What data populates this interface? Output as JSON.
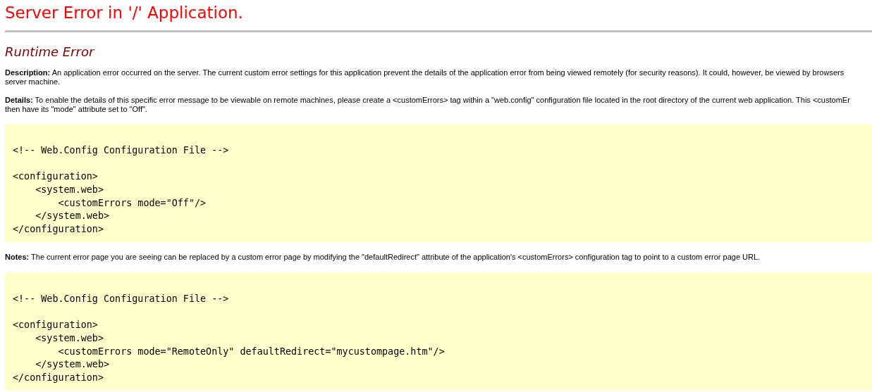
{
  "title": "Server Error in '/' Application.",
  "error_heading": "Runtime Error",
  "description": {
    "lines": [
      "**Description:** An application error occurred on the server. The current custom error settings for this application prevent the details of the application error from being viewed remotely (for security reasons). It could, however, be viewed by browsers",
      "server machine."
    ]
  },
  "details": {
    "lines": [
      "**Details:** To enable the details of this specific error message to be viewable on remote machines, please create a <customErrors> tag within a \"web.config\" configuration file located in the root directory of the current web application. This <customEr",
      "then have its \"mode\" attribute set to \"Off\"."
    ]
  },
  "code_block_1": {
    "comment": "<!-- Web.Config Configuration File -->",
    "lines": [
      "<configuration>",
      "    <system.web>",
      "        <customErrors mode=\"Off\"/>",
      "    </system.web>",
      "</configuration>"
    ]
  },
  "notes": {
    "lines": [
      "**Notes:** The current error page you are seeing can be replaced by a custom error page by modifying the \"defaultRedirect\" attribute of the application's <customErrors> configuration tag to point to a custom error page URL."
    ]
  },
  "code_block_2": {
    "comment": "<!-- Web.Config Configuration File -->",
    "lines": [
      "<configuration>",
      "    <system.web>",
      "        <customErrors mode=\"RemoteOnly\" defaultRedirect=\"mycustompage.htm\"/>",
      "    </system.web>",
      "</configuration>"
    ]
  }
}
